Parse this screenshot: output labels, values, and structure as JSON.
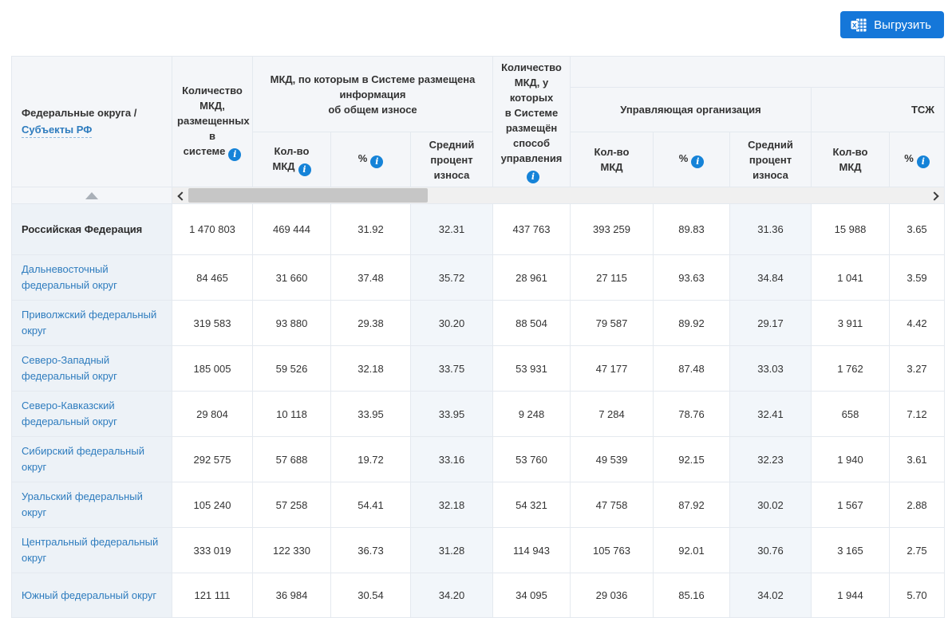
{
  "toolbar": {
    "export_label": "Выгрузить"
  },
  "colors": {
    "accent_blue": "#1577d9",
    "link_blue": "#2e7cbe",
    "info_icon_blue": "#1583d8",
    "header_bg": "#f4f6f9",
    "region_col_bg": "#edf2f7",
    "tint_col_bg": "#f2f6fa"
  },
  "table": {
    "header": {
      "region_line1": "Федеральные округа /",
      "region_link": "Субъекты РФ",
      "total_mkd": "Количество\nМКД,\nразмещенных в\nсистеме",
      "group_wear": "МКД, по которым в Системе размещена\nинформация\nоб общем износе",
      "mgmt": "Количество\nМКД, у которых\nв Системе\nразмещён\nспособ\nуправления",
      "group_uo": "Управляющая организация",
      "group_tsj": "ТСЖ",
      "leaf_count": "Кол-во\nМКД",
      "leaf_pct": "%",
      "leaf_avg": "Средний\nпроцент износа"
    },
    "rows": [
      {
        "region": "Российская Федерация",
        "total": true,
        "values": [
          "1 470 803",
          "469 444",
          "31.92",
          "32.31",
          "437 763",
          "393 259",
          "89.83",
          "31.36",
          "15 988",
          "3.65"
        ]
      },
      {
        "region": "Дальневосточный федеральный округ",
        "total": false,
        "values": [
          "84 465",
          "31 660",
          "37.48",
          "35.72",
          "28 961",
          "27 115",
          "93.63",
          "34.84",
          "1 041",
          "3.59"
        ]
      },
      {
        "region": "Приволжский федеральный округ",
        "total": false,
        "values": [
          "319 583",
          "93 880",
          "29.38",
          "30.20",
          "88 504",
          "79 587",
          "89.92",
          "29.17",
          "3 911",
          "4.42"
        ]
      },
      {
        "region": "Северо-Западный федеральный округ",
        "total": false,
        "values": [
          "185 005",
          "59 526",
          "32.18",
          "33.75",
          "53 931",
          "47 177",
          "87.48",
          "33.03",
          "1 762",
          "3.27"
        ]
      },
      {
        "region": "Северо-Кавказский федеральный округ",
        "total": false,
        "values": [
          "29 804",
          "10 118",
          "33.95",
          "33.95",
          "9 248",
          "7 284",
          "78.76",
          "32.41",
          "658",
          "7.12"
        ]
      },
      {
        "region": "Сибирский федеральный округ",
        "total": false,
        "values": [
          "292 575",
          "57 688",
          "19.72",
          "33.16",
          "53 760",
          "49 539",
          "92.15",
          "32.23",
          "1 940",
          "3.61"
        ]
      },
      {
        "region": "Уральский федеральный округ",
        "total": false,
        "values": [
          "105 240",
          "57 258",
          "54.41",
          "32.18",
          "54 321",
          "47 758",
          "87.92",
          "30.02",
          "1 567",
          "2.88"
        ]
      },
      {
        "region": "Центральный федеральный округ",
        "total": false,
        "values": [
          "333 019",
          "122 330",
          "36.73",
          "31.28",
          "114 943",
          "105 763",
          "92.01",
          "30.76",
          "3 165",
          "2.75"
        ]
      },
      {
        "region": "Южный федеральный округ",
        "total": false,
        "values": [
          "121 111",
          "36 984",
          "30.54",
          "34.20",
          "34 095",
          "29 036",
          "85.16",
          "34.02",
          "1 944",
          "5.70"
        ]
      }
    ]
  }
}
